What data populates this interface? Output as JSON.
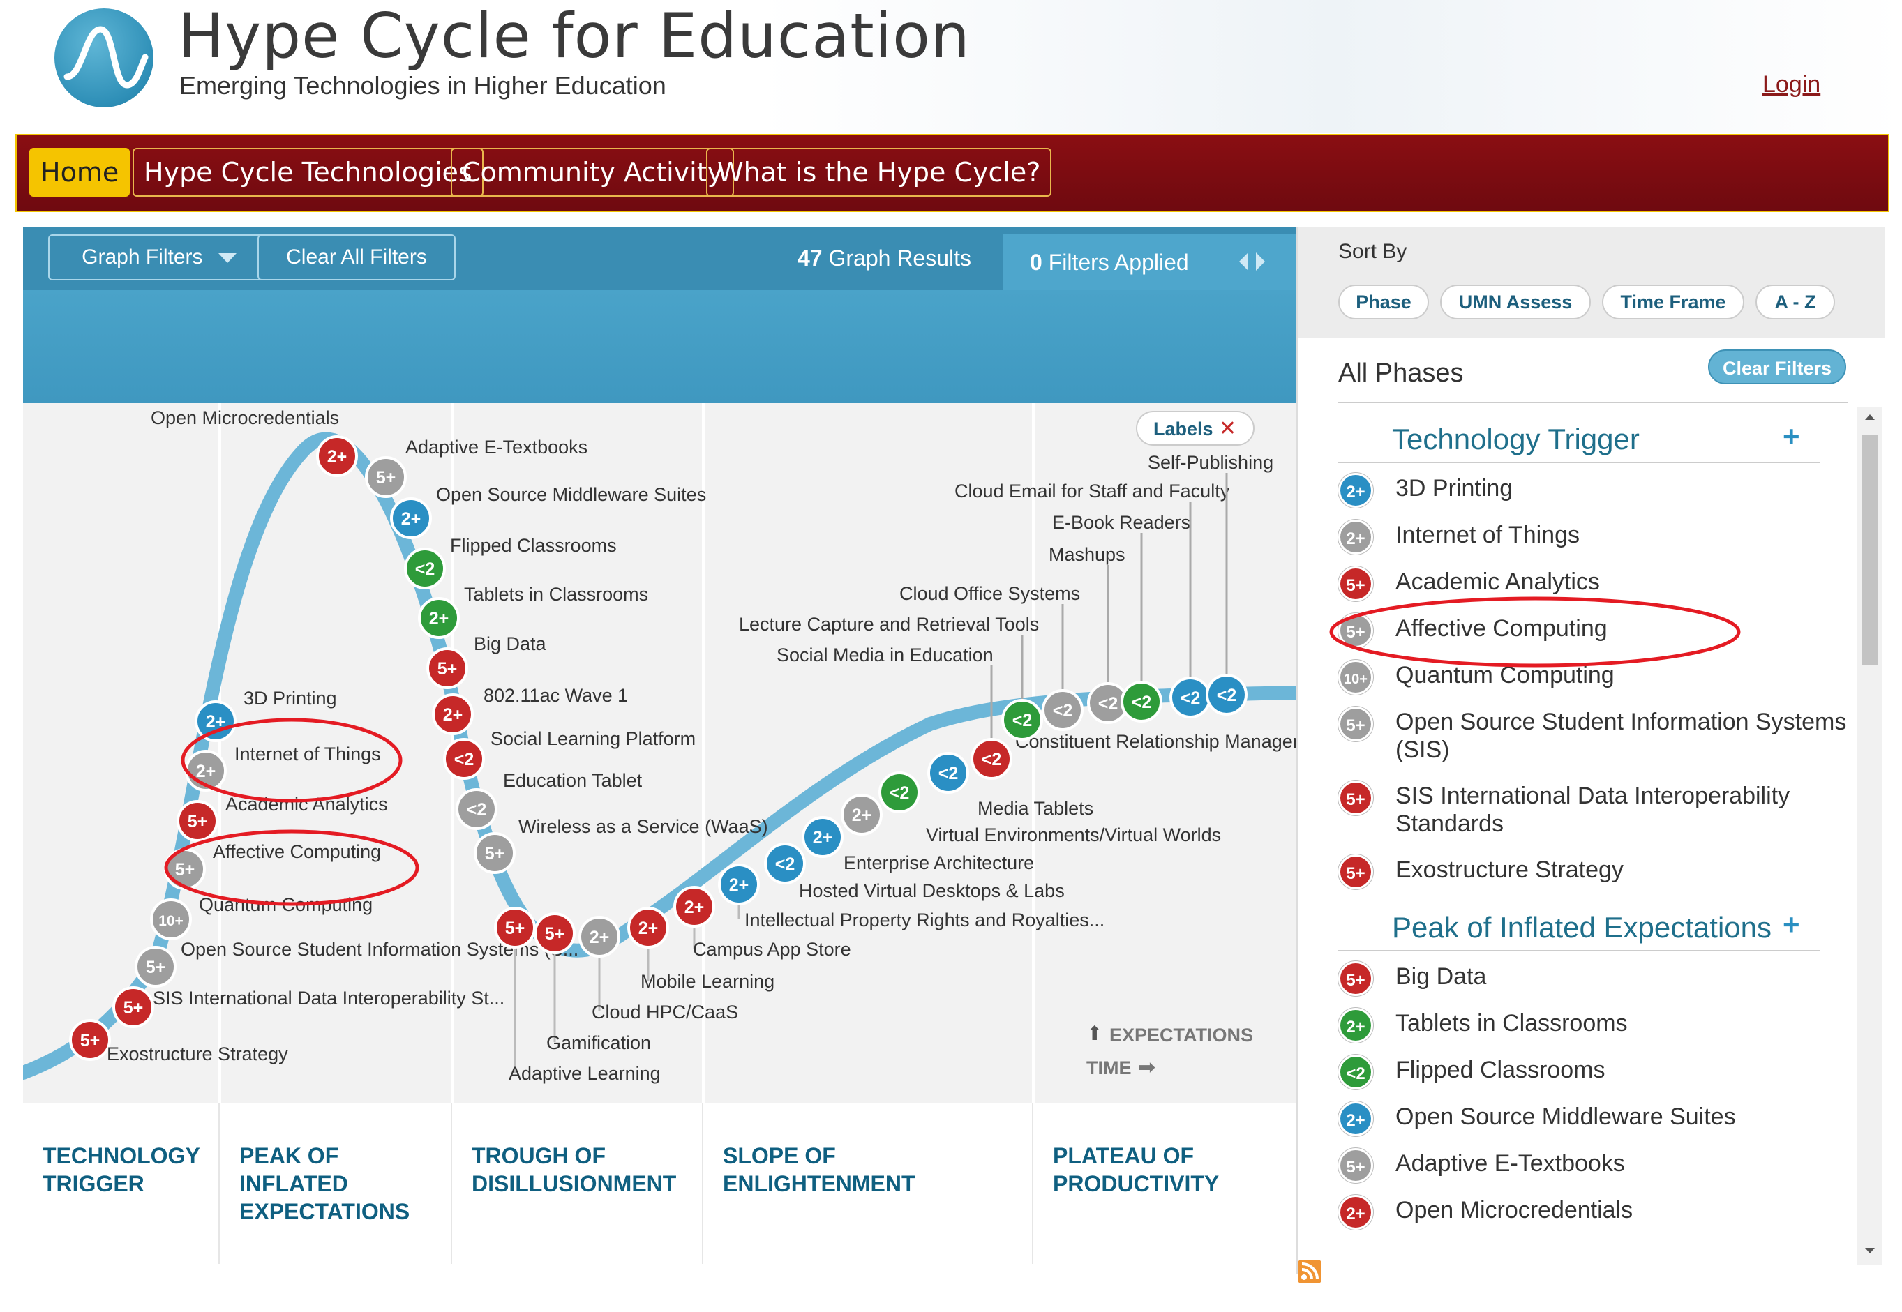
{
  "header": {
    "title": "Hype Cycle for Education",
    "subtitle": "Emerging Technologies in Higher Education",
    "login": "Login"
  },
  "nav": [
    {
      "label": "Home",
      "active": true
    },
    {
      "label": "Hype Cycle Technologies"
    },
    {
      "label": "Community Activity"
    },
    {
      "label": "What is the Hype Cycle?"
    }
  ],
  "toolbar": {
    "graph_filters": "Graph Filters",
    "clear_all": "Clear All Filters",
    "results_count": "47",
    "results_label": " Graph Results",
    "filters_count": "0",
    "filters_label": " Filters Applied"
  },
  "graph": {
    "labels_button": "Labels",
    "expectations": "EXPECTATIONS",
    "time": "TIME"
  },
  "colors": {
    "blue": "#2a8fc4",
    "gray": "#9e9e9e",
    "red": "#c62828",
    "green": "#2e9b3a"
  },
  "technologies": [
    {
      "name": "Open Microcredentials",
      "badge": "2+",
      "color": "red"
    },
    {
      "name": "Adaptive E-Textbooks",
      "badge": "5+",
      "color": "gray"
    },
    {
      "name": "Open Source Middleware Suites",
      "badge": "2+",
      "color": "blue"
    },
    {
      "name": "Flipped Classrooms",
      "badge": "<2",
      "color": "green"
    },
    {
      "name": "Tablets in Classrooms",
      "badge": "2+",
      "color": "green"
    },
    {
      "name": "Big Data",
      "badge": "5+",
      "color": "red"
    },
    {
      "name": "802.11ac Wave 1",
      "badge": "2+",
      "color": "red"
    },
    {
      "name": "Social Learning Platform",
      "badge": "<2",
      "color": "red"
    },
    {
      "name": "Education Tablet",
      "badge": "<2",
      "color": "gray"
    },
    {
      "name": "Wireless as a Service (WaaS)",
      "badge": "5+",
      "color": "gray"
    },
    {
      "name": "3D Printing",
      "badge": "2+",
      "color": "blue"
    },
    {
      "name": "Internet of Things",
      "badge": "2+",
      "color": "gray"
    },
    {
      "name": "Academic Analytics",
      "badge": "5+",
      "color": "red"
    },
    {
      "name": "Affective Computing",
      "badge": "5+",
      "color": "gray"
    },
    {
      "name": "Quantum Computing",
      "badge": "10+",
      "color": "gray"
    },
    {
      "name": "Open Source Student Information Systems (S...",
      "badge": "5+",
      "color": "gray"
    },
    {
      "name": "SIS International Data Interoperability St...",
      "badge": "5+",
      "color": "red"
    },
    {
      "name": "Exostructure Strategy",
      "badge": "5+",
      "color": "red"
    },
    {
      "name": "Adaptive Learning",
      "badge": "5+",
      "color": "red"
    },
    {
      "name": "Gamification",
      "badge": "5+",
      "color": "red"
    },
    {
      "name": "Cloud HPC/CaaS",
      "badge": "2+",
      "color": "gray"
    },
    {
      "name": "Mobile Learning",
      "badge": "2+",
      "color": "red"
    },
    {
      "name": "Campus App Store",
      "badge": "2+",
      "color": "red"
    },
    {
      "name": "Intellectual Property Rights and Royalties...",
      "badge": "2+",
      "color": "blue"
    },
    {
      "name": "Hosted Virtual Desktops & Labs",
      "badge": "<2",
      "color": "blue"
    },
    {
      "name": "Enterprise Architecture",
      "badge": "2+",
      "color": "blue"
    },
    {
      "name": "Virtual Environments/Virtual Worlds",
      "badge": "2+",
      "color": "gray"
    },
    {
      "name": "Media Tablets",
      "badge": "<2",
      "color": "green"
    },
    {
      "name": "Constituent Relationship Management (CRM)",
      "badge": "<2",
      "color": "blue"
    },
    {
      "name": "Social Media in Education",
      "badge": "<2",
      "color": "red"
    },
    {
      "name": "Lecture Capture and Retrieval Tools",
      "badge": "<2",
      "color": "green"
    },
    {
      "name": "Cloud Office Systems",
      "badge": "<2",
      "color": "gray"
    },
    {
      "name": "Mashups",
      "badge": "<2",
      "color": "gray"
    },
    {
      "name": "E-Book Readers",
      "badge": "<2",
      "color": "green"
    },
    {
      "name": "Cloud Email for Staff and Faculty",
      "badge": "<2",
      "color": "blue"
    },
    {
      "name": "Self-Publishing",
      "badge": "<2",
      "color": "blue"
    }
  ],
  "phases": [
    "TECHNOLOGY TRIGGER",
    "PEAK OF INFLATED EXPECTATIONS",
    "TROUGH OF DISILLUSIONMENT",
    "SLOPE OF ENLIGHTENMENT",
    "PLATEAU OF PRODUCTIVITY"
  ],
  "sidebar": {
    "sort_by": "Sort By",
    "sort_buttons": [
      "Phase",
      "UMN Assess",
      "Time Frame",
      "A - Z"
    ],
    "all_phases": "All Phases",
    "clear_filters": "Clear Filters",
    "groups": [
      {
        "title": "Technology Trigger",
        "items": [
          {
            "name": "3D Printing",
            "badge": "2+",
            "color": "blue"
          },
          {
            "name": "Internet of Things",
            "badge": "2+",
            "color": "gray"
          },
          {
            "name": "Academic Analytics",
            "badge": "5+",
            "color": "red"
          },
          {
            "name": "Affective Computing",
            "badge": "5+",
            "color": "gray"
          },
          {
            "name": "Quantum Computing",
            "badge": "10+",
            "color": "gray"
          },
          {
            "name": "Open Source Student Information Systems (SIS)",
            "badge": "5+",
            "color": "gray"
          },
          {
            "name": "SIS International Data Interoperability Standards",
            "badge": "5+",
            "color": "red"
          },
          {
            "name": "Exostructure Strategy",
            "badge": "5+",
            "color": "red"
          }
        ]
      },
      {
        "title": "Peak of Inflated Expectations",
        "items": [
          {
            "name": "Big Data",
            "badge": "5+",
            "color": "red"
          },
          {
            "name": "Tablets in Classrooms",
            "badge": "2+",
            "color": "green"
          },
          {
            "name": "Flipped Classrooms",
            "badge": "<2",
            "color": "green"
          },
          {
            "name": "Open Source Middleware Suites",
            "badge": "2+",
            "color": "blue"
          },
          {
            "name": "Adaptive E-Textbooks",
            "badge": "5+",
            "color": "gray"
          },
          {
            "name": "Open Microcredentials",
            "badge": "2+",
            "color": "red"
          }
        ]
      }
    ]
  }
}
